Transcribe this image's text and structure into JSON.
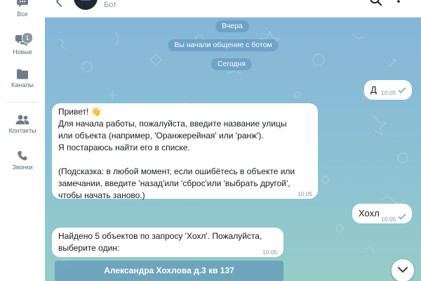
{
  "sidebar": {
    "items": [
      {
        "label": "Все",
        "icon": "chat-bubble-icon"
      },
      {
        "label": "Новые",
        "icon": "chat-bubbles-icon",
        "badge": "1"
      },
      {
        "label": "Каналы",
        "icon": "folder-icon"
      },
      {
        "label": "Контакты",
        "icon": "contacts-icon"
      },
      {
        "label": "Звонки",
        "icon": "phone-icon"
      }
    ]
  },
  "header": {
    "subtitle": "Бот",
    "icons": [
      "back-arrow-icon",
      "search-icon",
      "more-icon"
    ]
  },
  "chat": {
    "dividers": {
      "yesterday": "Вчера",
      "started": "Вы начали общение с ботом",
      "today": "Сегодня"
    },
    "messages": [
      {
        "direction": "out",
        "text": "Д",
        "time": "10:05",
        "status": "read"
      },
      {
        "direction": "in",
        "lines": [
          "Привет! 👋",
          "Для начала работы, пожалуйста, введите название улицы",
          "или объекта (например, 'Оранжерейная' или 'ранж').",
          "Я постараюсь найти его в списке.",
          "",
          "(Подсказка: в любой момент, если ошибётесь в объекте или",
          "замечании, введите 'назад'или 'сброс'или 'выбрать другой',",
          "чтобы начать заново.)"
        ],
        "time": "10:05"
      },
      {
        "direction": "out",
        "text": "Хохл",
        "time": "10:05",
        "status": "read"
      },
      {
        "direction": "in",
        "lines": [
          "Найдено 5 объектов по запросу 'Хохл'. Пожалуйста,",
          "выберите один:"
        ],
        "time": "10:05"
      }
    ],
    "keyboard_buttons": [
      "Александра Хохлова д.3 кв 137"
    ]
  },
  "colors": {
    "accent": "#5b9bc4",
    "bubble": "#ffffff",
    "pill": "#6a9fc3",
    "check": "#5aa0cf"
  }
}
